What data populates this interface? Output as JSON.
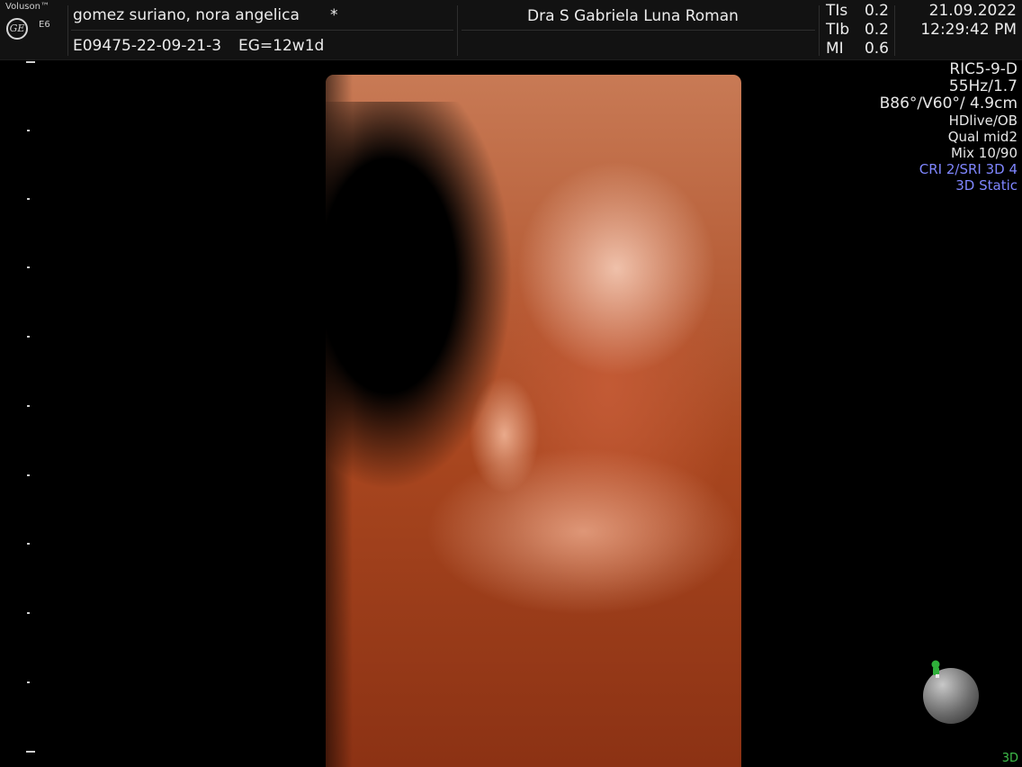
{
  "header": {
    "brand_name": "Voluson™",
    "model": "E6",
    "patient_name": "gomez suriano, nora angelica",
    "asterisk": "*",
    "patient_id": "E09475-22-09-21-3",
    "gestational_age": "EG=12w1d",
    "physician": "Dra S Gabriela Luna Roman",
    "indices": [
      {
        "label": "TIs",
        "value": "0.2"
      },
      {
        "label": "TIb",
        "value": "0.2"
      },
      {
        "label": "MI",
        "value": "0.6"
      }
    ],
    "date": "21.09.2022",
    "time": "12:29:42 PM"
  },
  "params": {
    "probe": "RIC5-9-D",
    "frame_rate": "55Hz/1.7",
    "volume_angles": "B86°/V60°/ 4.9cm",
    "render_mode": "HDlive/OB",
    "quality": "Qual mid2",
    "mix": "Mix 10/90",
    "cri_sri": "CRI 2/SRI 3D 4",
    "mode": "3D Static"
  },
  "corner_label": "3D",
  "colors": {
    "param_accent": "#7f86ff",
    "marker_green": "#2fb03a",
    "render_tone": "#c35a35"
  },
  "icons": {
    "ge_logo": "ge-logo",
    "orientation_ball": "orientation-sphere-icon",
    "orientation_marker": "green-marker-icon"
  },
  "ge_glyph": "GE"
}
